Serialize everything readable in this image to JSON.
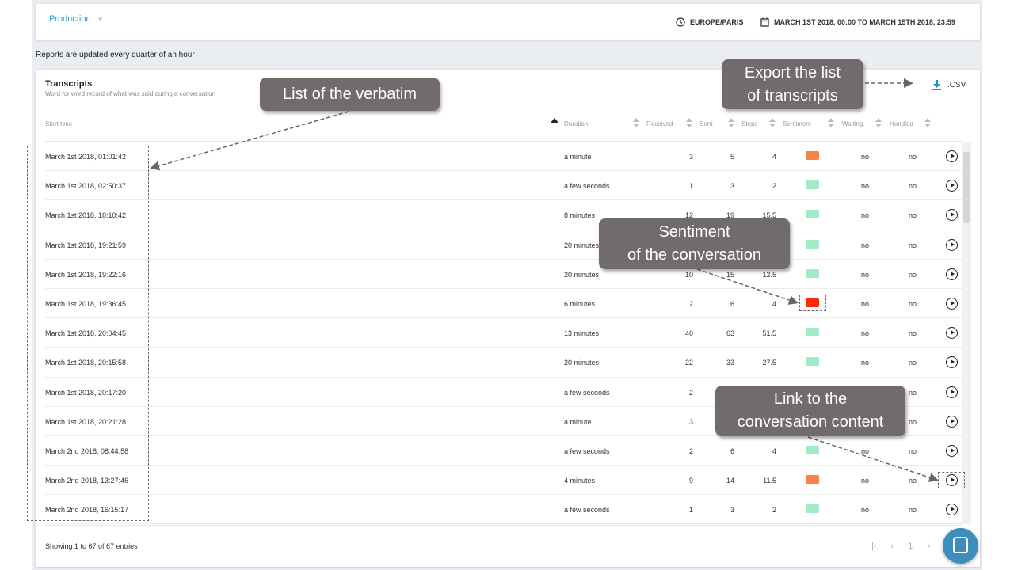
{
  "header": {
    "environment": "Production",
    "timezone": "EUROPE/PARIS",
    "date_range": "MARCH 1ST 2018, 00:00 TO MARCH 15TH 2018, 23:59"
  },
  "note": "Reports are updated every quarter of an hour",
  "transcripts": {
    "title": "Transcripts",
    "subtitle": "Word for word record of what was said during a conversation",
    "export_label": ".CSV",
    "columns": [
      "Start time",
      "Duration",
      "Received",
      "Sent",
      "Steps",
      "Sentiment",
      "Waiting",
      "Handled"
    ],
    "sentiment_colors": {
      "positive": "#a3ebc6",
      "mixed": "#f5834a",
      "negative": "#ff2a00"
    },
    "rows": [
      {
        "start": "March 1st 2018, 01:01:42",
        "duration": "a minute",
        "received": "3",
        "sent": "5",
        "steps": "4",
        "sentiment": "mixed",
        "waiting": "no",
        "handled": "no"
      },
      {
        "start": "March 1st 2018, 02:50:37",
        "duration": "a few seconds",
        "received": "1",
        "sent": "3",
        "steps": "2",
        "sentiment": "positive",
        "waiting": "no",
        "handled": "no"
      },
      {
        "start": "March 1st 2018, 18:10:42",
        "duration": "8 minutes",
        "received": "12",
        "sent": "19",
        "steps": "15.5",
        "sentiment": "positive",
        "waiting": "no",
        "handled": "no"
      },
      {
        "start": "March 1st 2018, 19:21:59",
        "duration": "20 minutes",
        "received": "",
        "sent": "",
        "steps": "",
        "sentiment": "positive",
        "waiting": "no",
        "handled": "no"
      },
      {
        "start": "March 1st 2018, 19:22:16",
        "duration": "20 minutes",
        "received": "10",
        "sent": "15",
        "steps": "12.5",
        "sentiment": "positive",
        "waiting": "no",
        "handled": "no"
      },
      {
        "start": "March 1st 2018, 19:36:45",
        "duration": "6 minutes",
        "received": "2",
        "sent": "6",
        "steps": "4",
        "sentiment": "negative",
        "waiting": "no",
        "handled": "no"
      },
      {
        "start": "March 1st 2018, 20:04:45",
        "duration": "13 minutes",
        "received": "40",
        "sent": "63",
        "steps": "51.5",
        "sentiment": "positive",
        "waiting": "no",
        "handled": "no"
      },
      {
        "start": "March 1st 2018, 20:15:58",
        "duration": "20 minutes",
        "received": "22",
        "sent": "33",
        "steps": "27.5",
        "sentiment": "positive",
        "waiting": "no",
        "handled": "no"
      },
      {
        "start": "March 1st 2018, 20:17:20",
        "duration": "a few seconds",
        "received": "2",
        "sent": "",
        "steps": "",
        "sentiment": "",
        "waiting": "",
        "handled": "no"
      },
      {
        "start": "March 1st 2018, 20:21:28",
        "duration": "a minute",
        "received": "3",
        "sent": "",
        "steps": "",
        "sentiment": "",
        "waiting": "",
        "handled": "no"
      },
      {
        "start": "March 2nd 2018, 08:44:58",
        "duration": "a few seconds",
        "received": "2",
        "sent": "6",
        "steps": "4",
        "sentiment": "positive",
        "waiting": "no",
        "handled": "no"
      },
      {
        "start": "March 2nd 2018, 13:27:46",
        "duration": "4 minutes",
        "received": "9",
        "sent": "14",
        "steps": "11.5",
        "sentiment": "mixed",
        "waiting": "no",
        "handled": "no"
      },
      {
        "start": "March 2nd 2018, 16:15:17",
        "duration": "a few seconds",
        "received": "1",
        "sent": "3",
        "steps": "2",
        "sentiment": "positive",
        "waiting": "no",
        "handled": "no"
      }
    ],
    "showing": "Showing 1 to 67 of 67 entries",
    "page": "1"
  },
  "callouts": {
    "verbatim": "List of the verbatim",
    "export_1": "Export the list",
    "export_2": "of transcripts",
    "sentiment_1": "Sentiment",
    "sentiment_2": "of the conversation",
    "link_1": "Link to the",
    "link_2": "conversation content"
  }
}
